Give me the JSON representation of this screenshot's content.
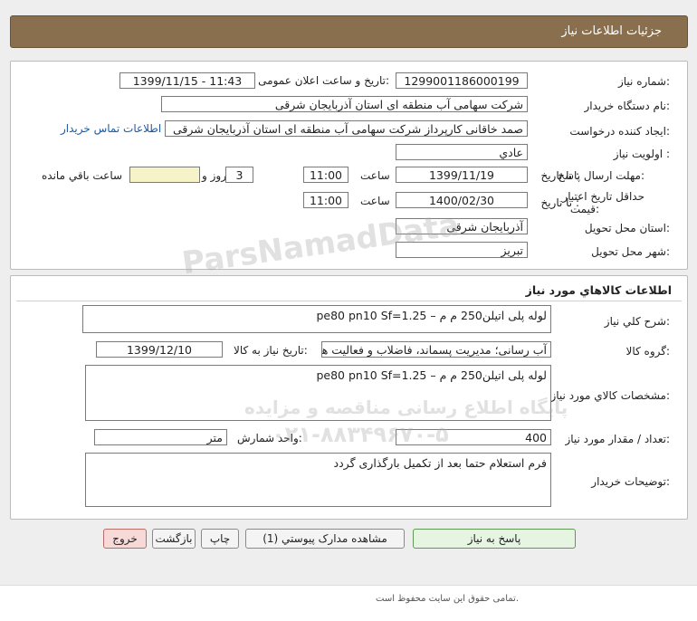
{
  "header": {
    "title": "جزئیات اطلاعات نیاز"
  },
  "fields": {
    "need_number_label": "شماره نیاز:",
    "need_number": "1299001186000199",
    "announce_label": "تاریخ و ساعت اعلان عمومی:",
    "announce_value": "1399/11/15 - 11:43",
    "buyer_org_label": "نام دستگاه خریدار:",
    "buyer_org": "شرکت سهامی آب منطقه ای استان آذربایجان شرقی",
    "creator_label": "ایجاد کننده درخواست:",
    "creator": "صمد خاقانی کارپرداز شرکت سهامی آب منطقه ای استان آذربایجان شرقی",
    "contact_link": "اطلاعات تماس خریدار",
    "priority_label": "اولویت نیاز :",
    "priority": "عادي",
    "deadline_label": "مهلت ارسال پاسخ:",
    "to_date_label": "تا تاریخ :",
    "deadline_date": "1399/11/19",
    "time_label": "ساعت",
    "deadline_time": "11:00",
    "days_label": "روز و",
    "days_value": "3",
    "remaining_value": "",
    "remaining_label": "ساعت باقي مانده",
    "validity_label_1": "حداقل تاریخ اعتبار",
    "validity_label_2": "قیمت:",
    "validity_to_label": "تا تاریخ :",
    "validity_date": "1400/02/30",
    "validity_time_label": "ساعت",
    "validity_time": "11:00",
    "province_label": "استان محل تحویل:",
    "province": "آذربایجان شرقی",
    "city_label": "شهر محل تحویل:",
    "city": "تبریز"
  },
  "goods": {
    "section_title": "اطلاعات کالاهاي مورد نياز",
    "summary_label": "شرح کلي نياز:",
    "summary": "لوله پلی اتیلن250 م م –   pe80    pn10 Sf=1.25",
    "group_label": "گروه کالا:",
    "group": "آب رسانی؛ مدیریت پسماند، فاضلاب و فعالیت ها",
    "need_date_label": "تاریخ نیاز به کالا:",
    "need_date": "1399/12/10",
    "specs_label": "مشخصات کالاي مورد نياز:",
    "specs": "لوله پلی اتیلن250 م م –   pe80    pn10 Sf=1.25",
    "qty_label": "تعداد / مقدار مورد نیاز:",
    "qty": "400",
    "unit_label": "واحد شمارش:",
    "unit": "متر",
    "notes_label": "توضیحات خریدار:",
    "notes": "فرم استعلام حتما بعد از تکمیل بارگذاری گردد"
  },
  "buttons": {
    "reply": "پاسخ به نیاز",
    "attachments": "مشاهده مدارک پیوستي (1)",
    "print": "چاپ",
    "back": "بازگشت",
    "exit": "خروج"
  },
  "footer": {
    "copyright": "تمامی حقوق این سایت محفوظ است."
  },
  "watermark": {
    "brand": "ParsNamadData",
    "line1": "پایگاه اطلاع رسانی مناقصه و مزایده",
    "line2": "۰۲۱-۸۸۳۴۹۶۷۰-۵"
  },
  "colors": {
    "header_bg": "#8a6f4e",
    "remaining_box": "#f6f3c9",
    "exit_button": "#f7d9d7",
    "reply_button": "#e6f4e2",
    "link": "#1a5aa8"
  }
}
